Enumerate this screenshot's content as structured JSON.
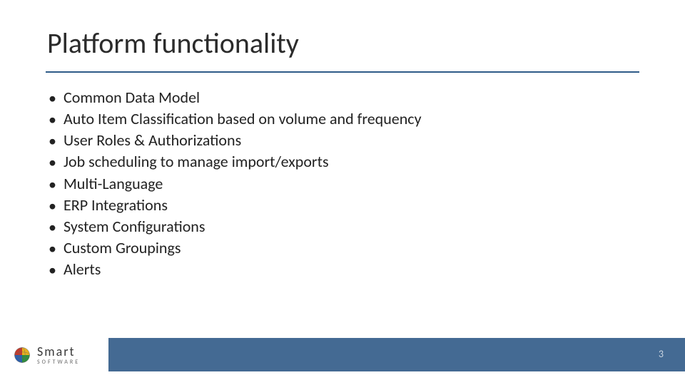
{
  "title": "Platform functionality",
  "bullets": [
    "Common Data Model",
    "Auto Item Classification based on volume and frequency",
    "User Roles & Authorizations",
    "Job scheduling to manage import/exports",
    "Multi-Language",
    "ERP Integrations",
    "System Configurations",
    "Custom Groupings",
    "Alerts"
  ],
  "footer": {
    "brand_primary": "Smart",
    "brand_secondary": "SOFTWARE",
    "page_number": "3"
  },
  "colors": {
    "rule": "#2f5b88",
    "footer_bar": "#446a93"
  }
}
